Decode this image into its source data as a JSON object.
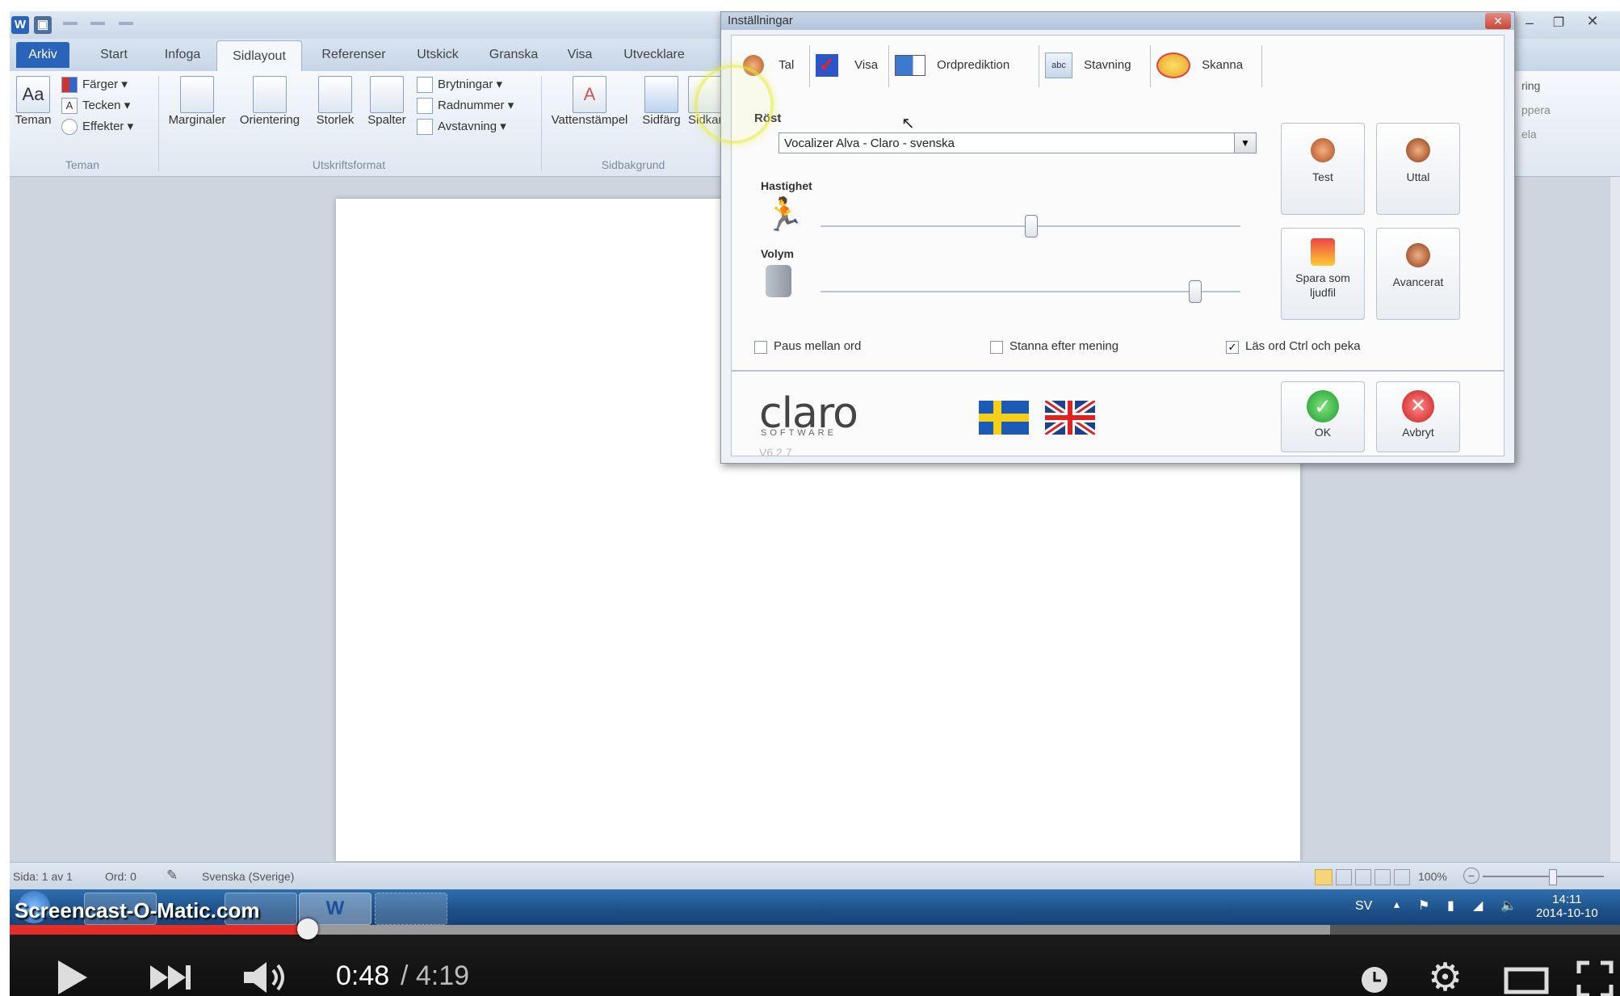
{
  "word": {
    "ribbon_tabs": [
      "Arkiv",
      "Start",
      "Infoga",
      "Sidlayout",
      "Referenser",
      "Utskick",
      "Granska",
      "Visa",
      "Utvecklare"
    ],
    "themes": {
      "big_label": "Teman",
      "small": [
        "Färger",
        "Tecken",
        "Effekter"
      ],
      "group": "Teman"
    },
    "page_setup": {
      "buttons": [
        "Marginaler",
        "Orientering",
        "Storlek",
        "Spalter"
      ],
      "small": [
        "Brytningar",
        "Radnummer",
        "Avstavning"
      ],
      "group": "Utskriftsformat"
    },
    "page_background": {
      "buttons": [
        "Vattenstämpel",
        "Sidfärg",
        "Sidkantlinjer"
      ],
      "group": "Sidbakgrund"
    },
    "right_group": [
      "ring",
      "ppera",
      "ela"
    ],
    "status": {
      "page": "Sida: 1 av 1",
      "words": "Ord: 0",
      "language": "Svenska (Sverige)",
      "zoom": "100%"
    },
    "tray": {
      "lang": "SV",
      "time": "14:11",
      "date": "2014-10-10"
    }
  },
  "dialog": {
    "title": "Inställningar",
    "tabs": [
      "Tal",
      "Visa",
      "Ordprediktion",
      "Stavning",
      "Skanna"
    ],
    "voice_label": "Röst",
    "voice_value": "Vocalizer Alva - Claro - svenska",
    "speed_label": "Hastighet",
    "speed_value": 0.5,
    "volume_label": "Volym",
    "volume_value": 0.89,
    "buttons": {
      "test": "Test",
      "say": "Uttal",
      "save_line1": "Spara som",
      "save_line2": "ljudfil",
      "advanced": "Avancerat",
      "ok": "OK",
      "cancel": "Avbryt"
    },
    "checkboxes": [
      {
        "label": "Paus mellan ord",
        "checked": false
      },
      {
        "label": "Stanna efter mening",
        "checked": false
      },
      {
        "label": "Läs ord Ctrl och peka",
        "checked": true
      }
    ],
    "logo": "claro",
    "logo_sub": "SOFTWARE",
    "version": "V6.2.7"
  },
  "player": {
    "watermark": "Screencast-O-Matic.com",
    "time_current": "0:48",
    "time_total": "/ 4:19",
    "progress": 0.185,
    "buffered": 0.82,
    "colors": {
      "progress": "#e52d27",
      "accent": "#2a64b8"
    }
  }
}
